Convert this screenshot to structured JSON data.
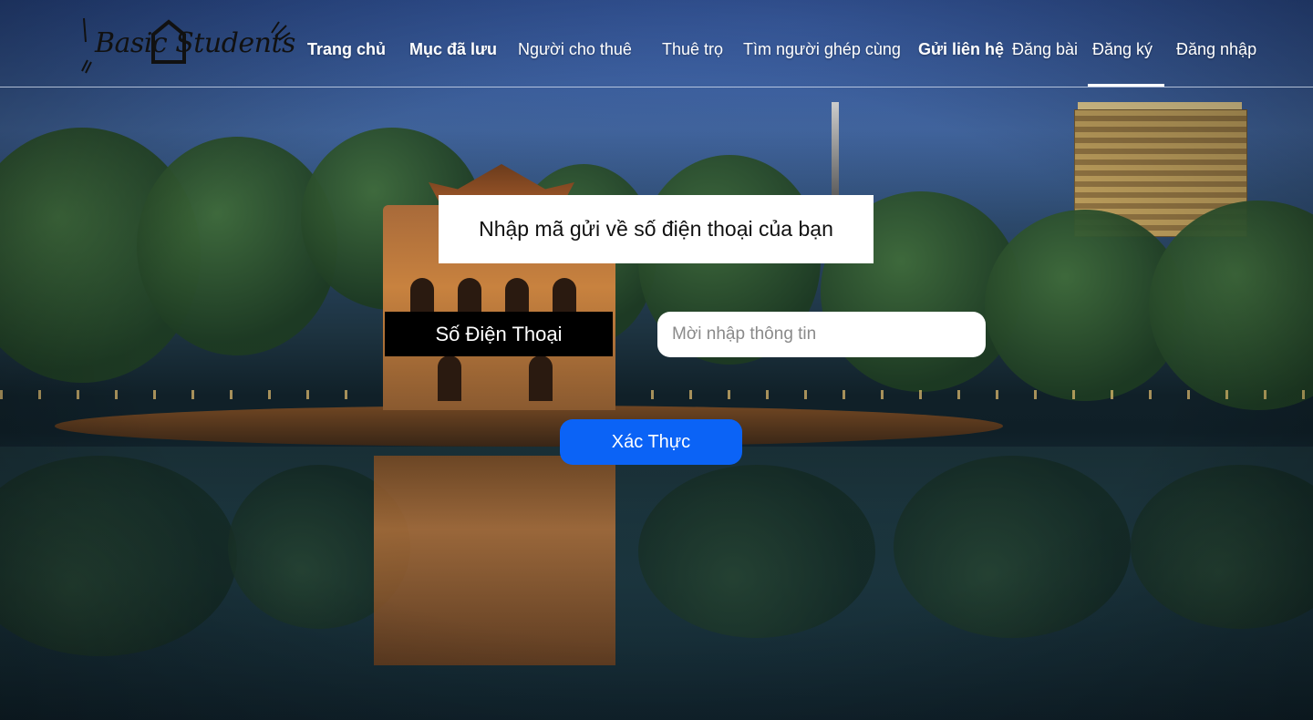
{
  "brand": {
    "logo_text": "Basic  Students",
    "logo_icon": "house-icon"
  },
  "nav": {
    "items": [
      {
        "label": "Trang chủ"
      },
      {
        "label": "Mục đã lưu"
      },
      {
        "label": "Người cho thuê"
      },
      {
        "label": "Thuê trọ"
      },
      {
        "label": "Tìm người ghép cùng"
      },
      {
        "label": "Gửi liên hệ"
      },
      {
        "label": "Đăng bài"
      },
      {
        "label": "Đăng ký"
      },
      {
        "label": "Đăng nhập"
      }
    ],
    "active": "Đăng ký"
  },
  "form": {
    "title": "Nhập mã gửi về số điện thoại của bạn",
    "phone_label": "Số Điện Thoại",
    "phone_placeholder": "Mời nhập thông tin",
    "phone_value": "",
    "submit_label": "Xác Thực"
  },
  "colors": {
    "primary_button": "#0b63f6",
    "label_bg": "#000000",
    "card_bg": "#ffffff",
    "nav_text": "#ffffff"
  }
}
